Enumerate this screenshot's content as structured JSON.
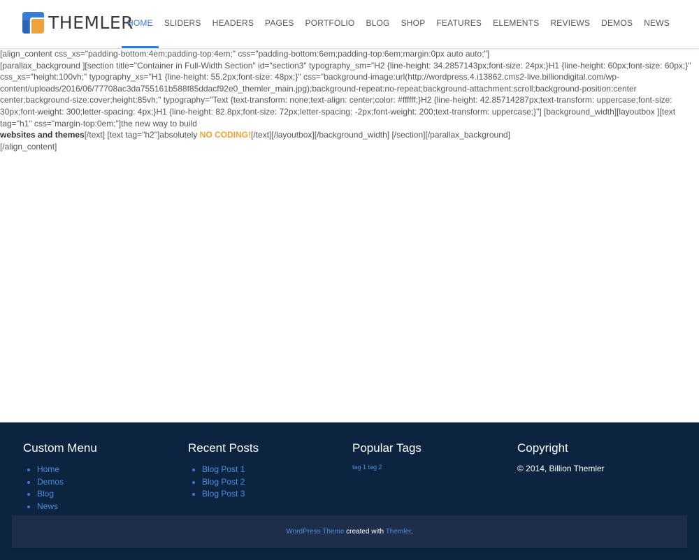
{
  "header": {
    "logo_text": "THEMLER",
    "nav": [
      {
        "label": "HOME",
        "active": true
      },
      {
        "label": "SLIDERS"
      },
      {
        "label": "HEADERS"
      },
      {
        "label": "PAGES"
      },
      {
        "label": "PORTFOLIO"
      },
      {
        "label": "BLOG"
      },
      {
        "label": "SHOP"
      },
      {
        "label": "FEATURES"
      },
      {
        "label": "ELEMENTS"
      },
      {
        "label": "REVIEWS"
      },
      {
        "label": "DEMOS"
      },
      {
        "label": "NEWS"
      }
    ],
    "accent_color": "#3a7bd5",
    "logo_colors": [
      "#f0a23a",
      "#3a7bd5"
    ]
  },
  "content": {
    "line1": "[align_content css_xs=\"padding-bottom:4em;padding-top:4em;\" css=\"padding-bottom:6em;padding-top:6em;margin:0px auto auto;\"]",
    "line2": "[parallax_background ][section title=\"Container in Full-Width Section\" id=\"section3\" typography_sm=\"H2 {line-height: 34.2857143px;font-size: 24px;}H1 {line-height: 60px;font-size: 60px;}\" css_xs=\"height:100vh;\" typography_xs=\"H1 {line-height: 55.2px;font-size: 48px;}\" css=\"background-image:url(http://wordpress.4.i13862.cms2-live.billiondigital.com/wp-content/uploads/2016/06/77708ac3da755161b588f85ddacf92e0_themler_main.jpg);background-repeat:no-repeat;background-attachment:scroll;background-position:center center;background-size:cover;height:85vh;\" typography=\"Text {text-transform: none;text-align: center;color: #ffffff;}H2 {line-height: 42.85714287px;text-transform: uppercase;font-size: 30px;font-weight: 300;letter-spacing: 4px;}H1 {line-height: 82.8px;font-size: 72px;letter-spacing: -2px;font-weight: 200;text-transform: uppercase;}\"] [background_width][layoutbox ][text tag=\"h1\" css=\"margin-top:0em;\"]the new way to build",
    "line3_bold": "websites and themes",
    "line3_mid": "[/text] [text tag=\"h2\"]absolutely ",
    "line3_orange": "NO CODING!",
    "line3_end": "[/text][/layoutbox][/background_width] [/section][/parallax_background]",
    "line4": "[/align_content]",
    "highlight_color": "#f0a23a"
  },
  "footer": {
    "custom_menu": {
      "title": "Custom Menu",
      "items": [
        "Home",
        "Demos",
        "Blog",
        "News"
      ]
    },
    "recent_posts": {
      "title": "Recent Posts",
      "items": [
        "Blog Post 1",
        "Blog Post 2",
        "Blog Post 3"
      ]
    },
    "popular_tags": {
      "title": "Popular Tags",
      "tags": "tag 1 tag 2"
    },
    "copyright": {
      "title": "Copyright",
      "text": "© 2014, Billion Themler"
    },
    "bottom": {
      "link1": "WordPress Theme",
      "mid": " created with ",
      "link2": "Themler",
      "end": "."
    },
    "bg_color": "#0d2440",
    "bar_color": "#1e2e4a"
  }
}
